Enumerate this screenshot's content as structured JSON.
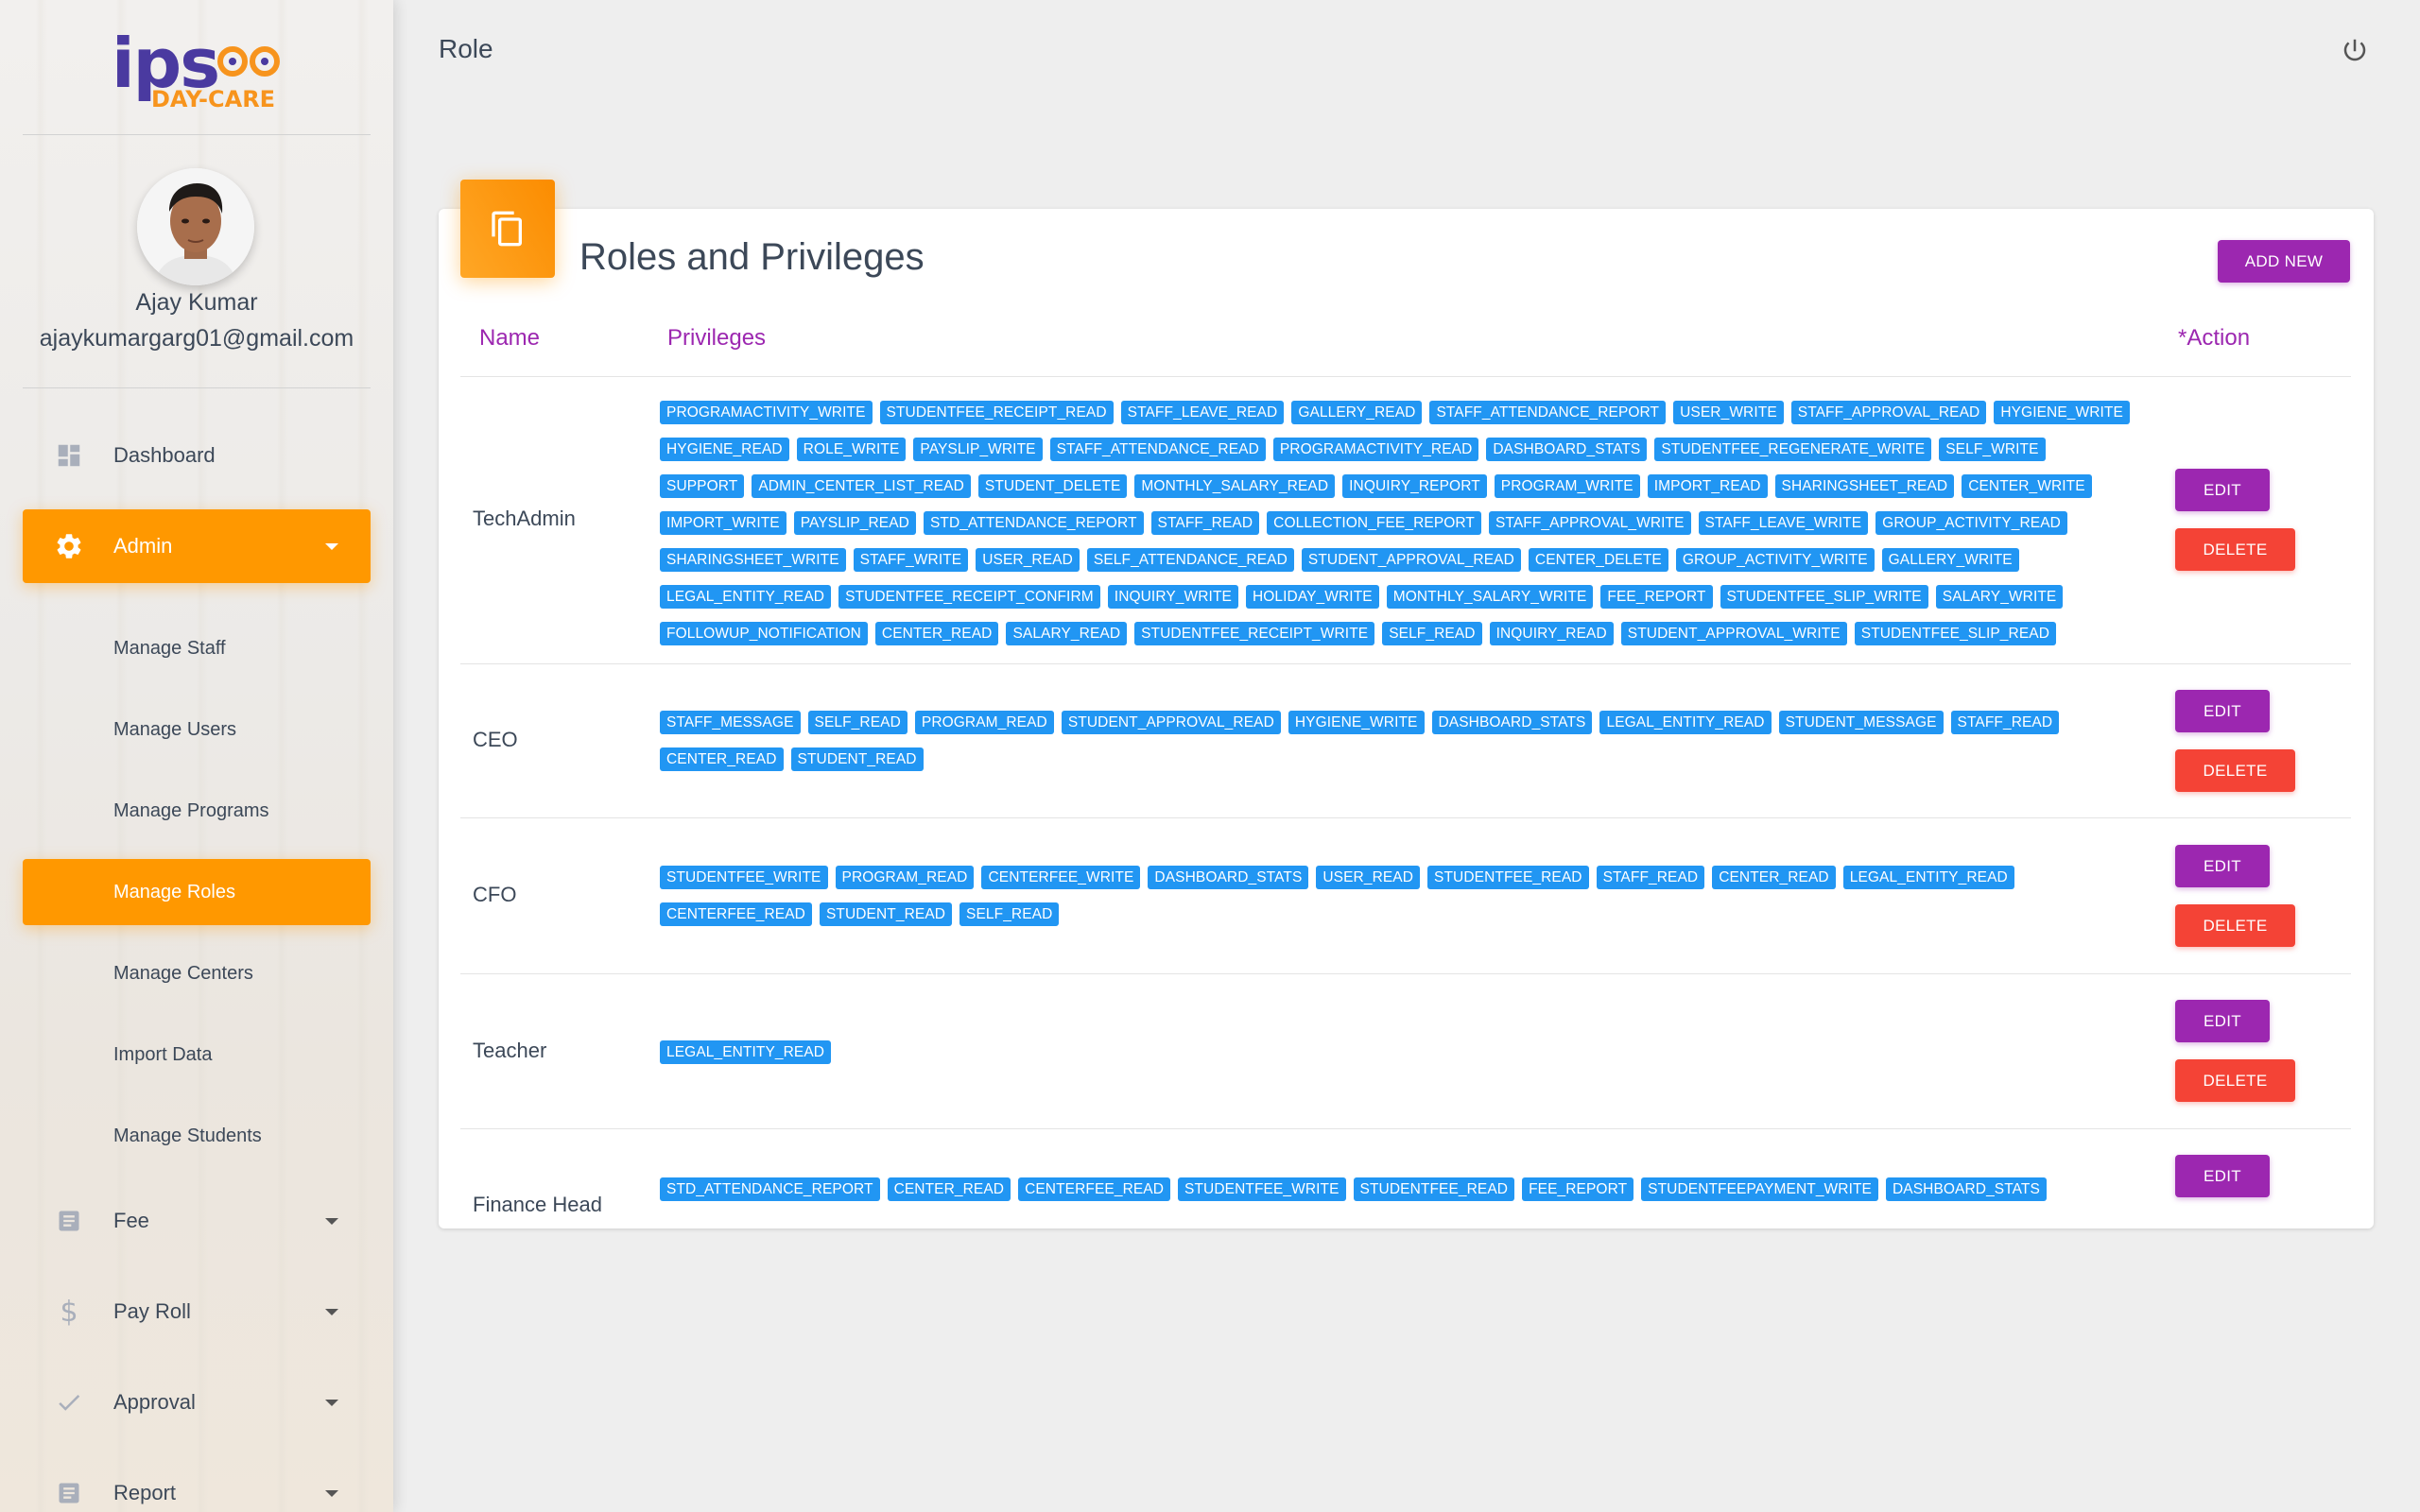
{
  "page": {
    "title": "Role"
  },
  "logo": {
    "top": "ips",
    "bottom": "DAY-CARE"
  },
  "user": {
    "name": "Ajay Kumar",
    "email": "ajaykumargarg01@gmail.com"
  },
  "nav": {
    "dashboard": "Dashboard",
    "admin": "Admin",
    "admin_sub": [
      "Manage Staff",
      "Manage Users",
      "Manage Programs",
      "Manage Roles",
      "Manage Centers",
      "Import Data",
      "Manage Students"
    ],
    "fee": "Fee",
    "payroll": "Pay Roll",
    "approval": "Approval",
    "report": "Report"
  },
  "card": {
    "title": "Roles and Privileges",
    "add_new": "ADD NEW",
    "headers": {
      "name": "Name",
      "privileges": "Privileges",
      "action": "*Action"
    },
    "edit_label": "EDIT",
    "delete_label": "DELETE"
  },
  "roles": [
    {
      "name": "TechAdmin",
      "privileges": [
        "PROGRAMACTIVITY_WRITE",
        "STUDENTFEE_RECEIPT_READ",
        "STAFF_LEAVE_READ",
        "GALLERY_READ",
        "STAFF_ATTENDANCE_REPORT",
        "USER_WRITE",
        "STAFF_APPROVAL_READ",
        "HYGIENE_WRITE",
        "HYGIENE_READ",
        "ROLE_WRITE",
        "PAYSLIP_WRITE",
        "STAFF_ATTENDANCE_READ",
        "PROGRAMACTIVITY_READ",
        "DASHBOARD_STATS",
        "STUDENTFEE_REGENERATE_WRITE",
        "SELF_WRITE",
        "SUPPORT",
        "ADMIN_CENTER_LIST_READ",
        "STUDENT_DELETE",
        "MONTHLY_SALARY_READ",
        "INQUIRY_REPORT",
        "PROGRAM_WRITE",
        "IMPORT_READ",
        "SHARINGSHEET_READ",
        "CENTER_WRITE",
        "IMPORT_WRITE",
        "PAYSLIP_READ",
        "STD_ATTENDANCE_REPORT",
        "STAFF_READ",
        "COLLECTION_FEE_REPORT",
        "STAFF_APPROVAL_WRITE",
        "STAFF_LEAVE_WRITE",
        "GROUP_ACTIVITY_READ",
        "SHARINGSHEET_WRITE",
        "STAFF_WRITE",
        "USER_READ",
        "SELF_ATTENDANCE_READ",
        "STUDENT_APPROVAL_READ",
        "CENTER_DELETE",
        "GROUP_ACTIVITY_WRITE",
        "GALLERY_WRITE",
        "LEGAL_ENTITY_READ",
        "STUDENTFEE_RECEIPT_CONFIRM",
        "INQUIRY_WRITE",
        "HOLIDAY_WRITE",
        "MONTHLY_SALARY_WRITE",
        "FEE_REPORT",
        "STUDENTFEE_SLIP_WRITE",
        "SALARY_WRITE",
        "FOLLOWUP_NOTIFICATION",
        "CENTER_READ",
        "SALARY_READ",
        "STUDENTFEE_RECEIPT_WRITE",
        "SELF_READ",
        "INQUIRY_READ",
        "STUDENT_APPROVAL_WRITE",
        "STUDENTFEE_SLIP_READ"
      ],
      "has_delete": true
    },
    {
      "name": "CEO",
      "privileges": [
        "STAFF_MESSAGE",
        "SELF_READ",
        "PROGRAM_READ",
        "STUDENT_APPROVAL_READ",
        "HYGIENE_WRITE",
        "DASHBOARD_STATS",
        "LEGAL_ENTITY_READ",
        "STUDENT_MESSAGE",
        "STAFF_READ",
        "CENTER_READ",
        "STUDENT_READ"
      ],
      "has_delete": true
    },
    {
      "name": "CFO",
      "privileges": [
        "STUDENTFEE_WRITE",
        "PROGRAM_READ",
        "CENTERFEE_WRITE",
        "DASHBOARD_STATS",
        "USER_READ",
        "STUDENTFEE_READ",
        "STAFF_READ",
        "CENTER_READ",
        "LEGAL_ENTITY_READ",
        "CENTERFEE_READ",
        "STUDENT_READ",
        "SELF_READ"
      ],
      "has_delete": true
    },
    {
      "name": "Teacher",
      "privileges": [
        "LEGAL_ENTITY_READ"
      ],
      "has_delete": true
    },
    {
      "name": "Finance Head",
      "privileges": [
        "STD_ATTENDANCE_REPORT",
        "CENTER_READ",
        "CENTERFEE_READ",
        "STUDENTFEE_WRITE",
        "STUDENTFEE_READ",
        "FEE_REPORT",
        "STUDENTFEEPAYMENT_WRITE",
        "DASHBOARD_STATS"
      ],
      "has_delete": false
    }
  ],
  "icons": {
    "dashboard": "dashboard-icon",
    "admin": "gear-icon",
    "fee": "receipt-icon",
    "payroll": "dollar-icon",
    "approval": "check-icon",
    "report": "report-icon",
    "power": "power-icon",
    "card": "copy-icon"
  },
  "colors": {
    "accent": "#ff9800",
    "purple": "#9c27b0",
    "red": "#f44336",
    "tag": "#2196f3"
  }
}
